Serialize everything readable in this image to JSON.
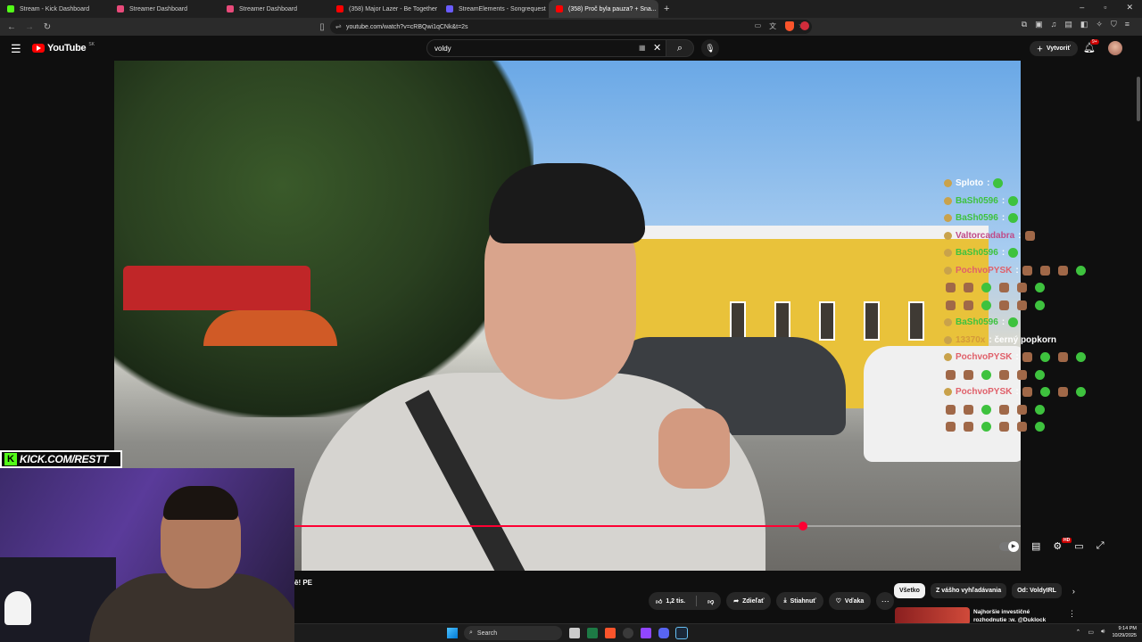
{
  "browser": {
    "tabs": [
      {
        "title": "Stream - Kick Dashboard",
        "color": "#53fc18",
        "active": false
      },
      {
        "title": "Streamer Dashboard",
        "color": "#e84a7a",
        "active": false
      },
      {
        "title": "Streamer Dashboard",
        "color": "#e84a7a",
        "active": false
      },
      {
        "title": "(358) Major Lazer - Be Together (feat",
        "color": "#ff0000",
        "active": false
      },
      {
        "title": "StreamElements - Songrequest",
        "color": "#6a5cff",
        "active": false
      },
      {
        "title": "(358) Proč byla pauza? + Sna...",
        "color": "#ff0000",
        "active": true
      }
    ],
    "new_tab_icon": "+",
    "url": "youtube.com/watch?v=cRBQwi1qCNk&t=2s"
  },
  "youtube": {
    "logo_text": "YouTube",
    "country_code": "SK",
    "search_value": "voldy",
    "create_label": "Vytvoriť",
    "notification_count": "9+",
    "video_title_fragment": "ě! PE",
    "actions": {
      "likes": "1,2 tis.",
      "share": "Zdieľať",
      "download": "Stiahnuť",
      "thanks": "Vďaka"
    },
    "chips": [
      "Všetko",
      "Z vášho vyhľadávania",
      "Od: VoldyIRL"
    ],
    "recommendation": {
      "title": "Najhoršie investičné rozhodnutie :w. @Duklock"
    },
    "progress": 0.7
  },
  "stream_overlay": {
    "kick_banner": "KICK.COM/RESTT",
    "kick_logo_letter": "K",
    "chat": [
      {
        "user": "Sploto",
        "text": ":",
        "color": "#ffffff",
        "emotes": [
          "g"
        ]
      },
      {
        "user": "BaSh0596",
        "text": ":",
        "color": "#3ec23e",
        "emotes": [
          "g"
        ]
      },
      {
        "user": "BaSh0596",
        "text": ":",
        "color": "#3ec23e",
        "emotes": [
          "g"
        ]
      },
      {
        "user": "Valtorcadabra",
        "text": ":",
        "color": "#c04a88",
        "emotes": [
          "f"
        ]
      },
      {
        "user": "BaSh0596",
        "text": ":",
        "color": "#3ec23e",
        "emotes": [
          "g"
        ]
      },
      {
        "user": "PochvoPYSK",
        "text": ":",
        "color": "#e0606a",
        "emotes": [
          "f",
          "f",
          "f",
          "g"
        ]
      },
      {
        "user": "",
        "text": "",
        "color": "#ffffff",
        "emotes": [
          "f",
          "f",
          "g",
          "f",
          "f",
          "g"
        ]
      },
      {
        "user": "",
        "text": "",
        "color": "#ffffff",
        "emotes": [
          "f",
          "f",
          "g",
          "f",
          "f",
          "g"
        ]
      },
      {
        "user": "BaSh0596",
        "text": ":",
        "color": "#3ec23e",
        "emotes": [
          "g"
        ]
      },
      {
        "user": "13370x",
        "text": ": černý popkorn",
        "color": "#d49a3a",
        "emotes": []
      },
      {
        "user": "PochvoPYSK",
        "text": ":",
        "color": "#e0606a",
        "emotes": [
          "f",
          "g",
          "f",
          "g"
        ]
      },
      {
        "user": "",
        "text": "",
        "color": "#ffffff",
        "emotes": [
          "f",
          "f",
          "g",
          "f",
          "f",
          "g"
        ]
      },
      {
        "user": "PochvoPYSK",
        "text": ":",
        "color": "#e0606a",
        "emotes": [
          "f",
          "g",
          "f",
          "g"
        ]
      },
      {
        "user": "",
        "text": "",
        "color": "#ffffff",
        "emotes": [
          "f",
          "f",
          "g",
          "f",
          "f",
          "g"
        ]
      },
      {
        "user": "",
        "text": "",
        "color": "#ffffff",
        "emotes": [
          "f",
          "f",
          "g",
          "f",
          "f",
          "g"
        ]
      }
    ]
  },
  "taskbar": {
    "search_placeholder": "Search",
    "time": "9:14 PM",
    "date": "10/29/2025"
  }
}
